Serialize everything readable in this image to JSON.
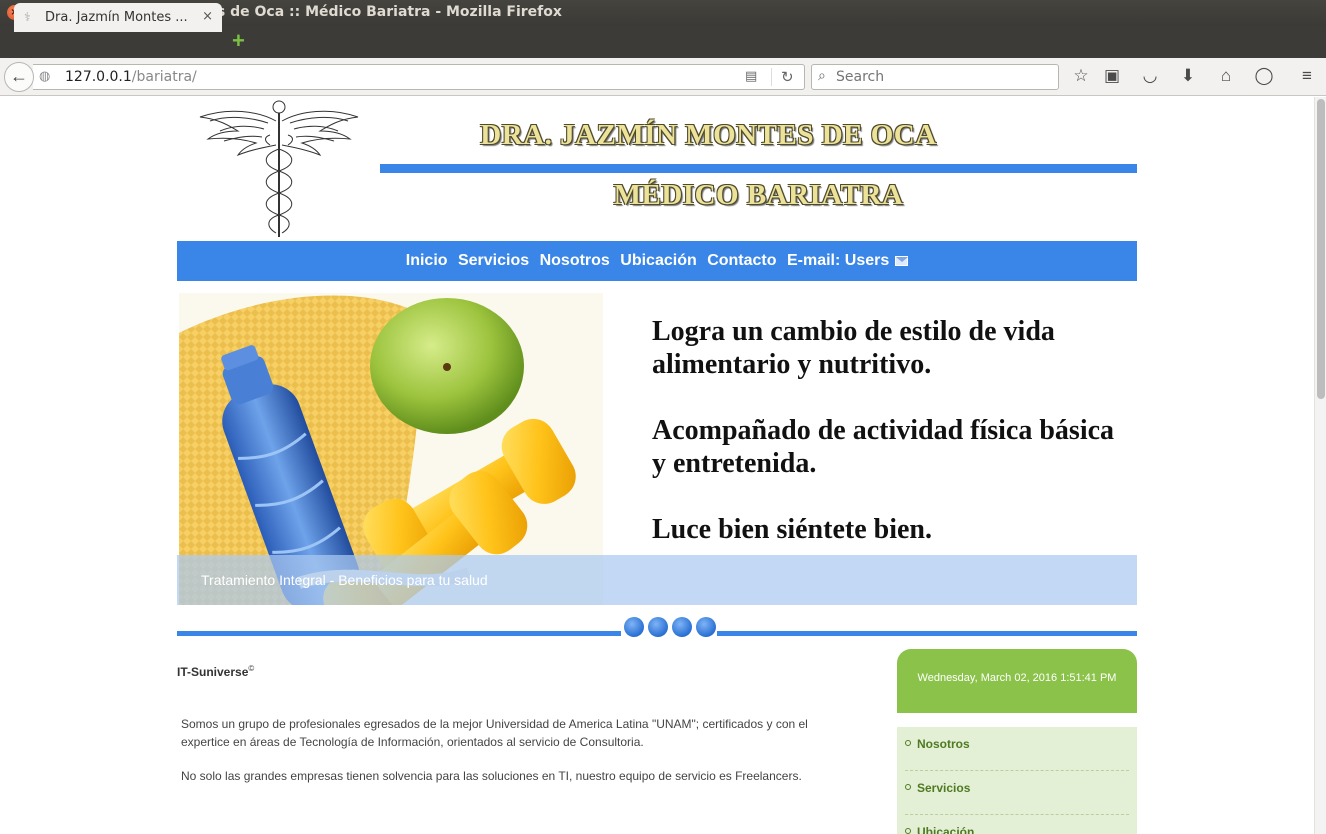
{
  "window": {
    "title": "Dra. Jazmín Montes de Oca :: Médico Bariatra - Mozilla Firefox",
    "close_glyph": "×",
    "min_glyph": "–",
    "max_glyph": "▫"
  },
  "tab": {
    "label": "Dra. Jazmín Montes ...",
    "close_glyph": "×",
    "newtab_glyph": "+"
  },
  "navbar": {
    "url_host": "127.0.0.1",
    "url_path": "/bariatra/",
    "search_placeholder": "Search"
  },
  "header": {
    "title": "DRA. JAZMÍN MONTES DE OCA",
    "subtitle": "MÉDICO BARIATRA"
  },
  "menu": {
    "inicio": "Inicio",
    "servicios": "Servicios",
    "nosotros": "Nosotros",
    "ubicacion": "Ubicación",
    "contacto": "Contacto",
    "email": "E-mail: Users"
  },
  "hero": {
    "line1": "Logra un cambio de estilo de vida alimentario y nutritivo.",
    "line2": "Acompañado de actividad física básica y entretenida.",
    "line3": "Luce bien siéntete bien.",
    "caption": "Tratamiento Integral - Beneficios para tu salud"
  },
  "footer": {
    "brand": "IT-Suniverse",
    "brand_mark": "©",
    "about1": "Somos un grupo de profesionales egresados de la mejor Universidad de America Latina \"UNAM\"; certificados y con el expertice en áreas de Tecnología de Información, orientados al servicio de Consultoria.",
    "about2": "No solo las grandes empresas tienen solvencia para las soluciones en TI, nuestro equipo de servicio es Freelancers."
  },
  "sidebar": {
    "datetime": "Wednesday, March 02, 2016 1:51:41 PM",
    "items": [
      "Nosotros",
      "Servicios",
      "Ubicación"
    ]
  },
  "colors": {
    "accent_blue": "#3a86e8",
    "sidebar_green": "#8bc34a",
    "header_gold": "#ede29a"
  },
  "icons": {
    "toolbar": [
      "bookmark-star-icon",
      "reading-list-icon",
      "pocket-icon",
      "download-icon",
      "home-icon",
      "chat-icon",
      "hamburger-menu-icon"
    ]
  }
}
